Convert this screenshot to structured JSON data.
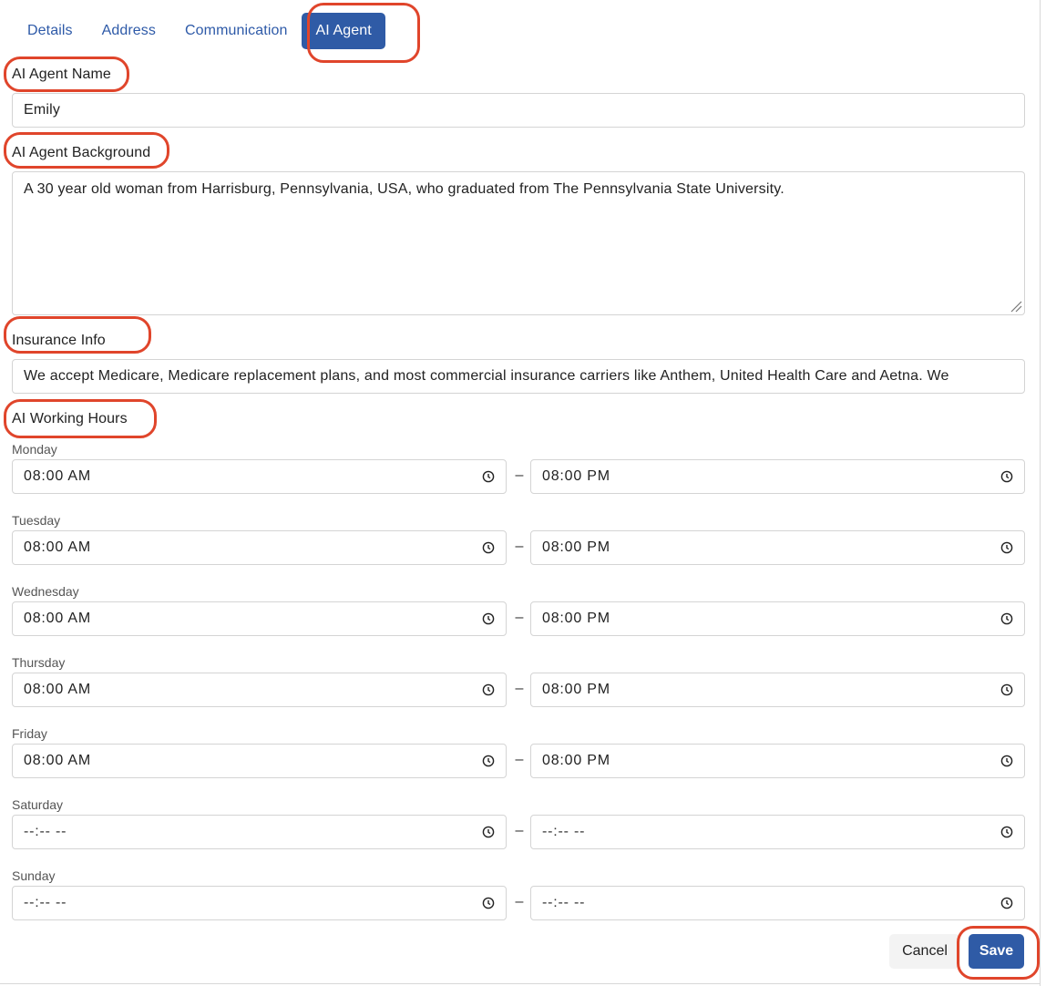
{
  "tabs": [
    {
      "label": "Details"
    },
    {
      "label": "Address"
    },
    {
      "label": "Communication"
    },
    {
      "label": "AI Agent",
      "active": true
    }
  ],
  "form": {
    "agent_name_label": "AI Agent Name",
    "agent_name_value": "Emily",
    "background_label": "AI Agent Background",
    "background_value": "A 30 year old woman from Harrisburg, Pennsylvania, USA, who graduated from The Pennsylvania State University.",
    "insurance_label": "Insurance Info",
    "insurance_value": "We accept Medicare, Medicare replacement plans, and most commercial insurance carriers like Anthem, United Health Care and Aetna. We",
    "hours_label": "AI Working Hours"
  },
  "hours": [
    {
      "day": "Monday",
      "start": "08:00  AM",
      "end": "08:00  PM"
    },
    {
      "day": "Tuesday",
      "start": "08:00  AM",
      "end": "08:00  PM"
    },
    {
      "day": "Wednesday",
      "start": "08:00  AM",
      "end": "08:00  PM"
    },
    {
      "day": "Thursday",
      "start": "08:00  AM",
      "end": "08:00  PM"
    },
    {
      "day": "Friday",
      "start": "08:00  AM",
      "end": "08:00  PM"
    },
    {
      "day": "Saturday",
      "start": "--:--  --",
      "end": "--:--  --"
    },
    {
      "day": "Sunday",
      "start": "--:--  --",
      "end": "--:--  --"
    }
  ],
  "range_separator": "–",
  "actions": {
    "cancel_label": "Cancel",
    "save_label": "Save"
  },
  "colors": {
    "accent": "#2f5ba6",
    "highlight_ring": "#e0452b",
    "link": "#2e5aa8"
  },
  "icons": {
    "time_picker": "clock-icon"
  }
}
